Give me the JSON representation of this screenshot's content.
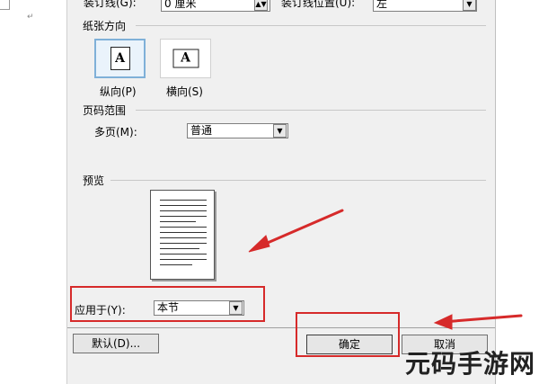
{
  "top_row": {
    "gutter_label": "装订线(G):",
    "gutter_value": "0 厘米",
    "gutter_pos_label": "装订线位置(U):",
    "gutter_pos_value": "左"
  },
  "orientation": {
    "title": "纸张方向",
    "glyph": "A",
    "portrait_label": "纵向(P)",
    "landscape_label": "横向(S)",
    "selected": "portrait"
  },
  "pages": {
    "title": "页码范围",
    "multi_label": "多页(M):",
    "multi_value": "普通"
  },
  "preview": {
    "title": "预览"
  },
  "apply": {
    "label": "应用于(Y):",
    "value": "本节"
  },
  "buttons": {
    "default_label": "默认(D)...",
    "ok_label": "确定",
    "cancel_label": "取消"
  },
  "colors": {
    "annotation_red": "#d62a2a",
    "selected_border": "#7fb0d8"
  },
  "watermark": "元码手游网"
}
